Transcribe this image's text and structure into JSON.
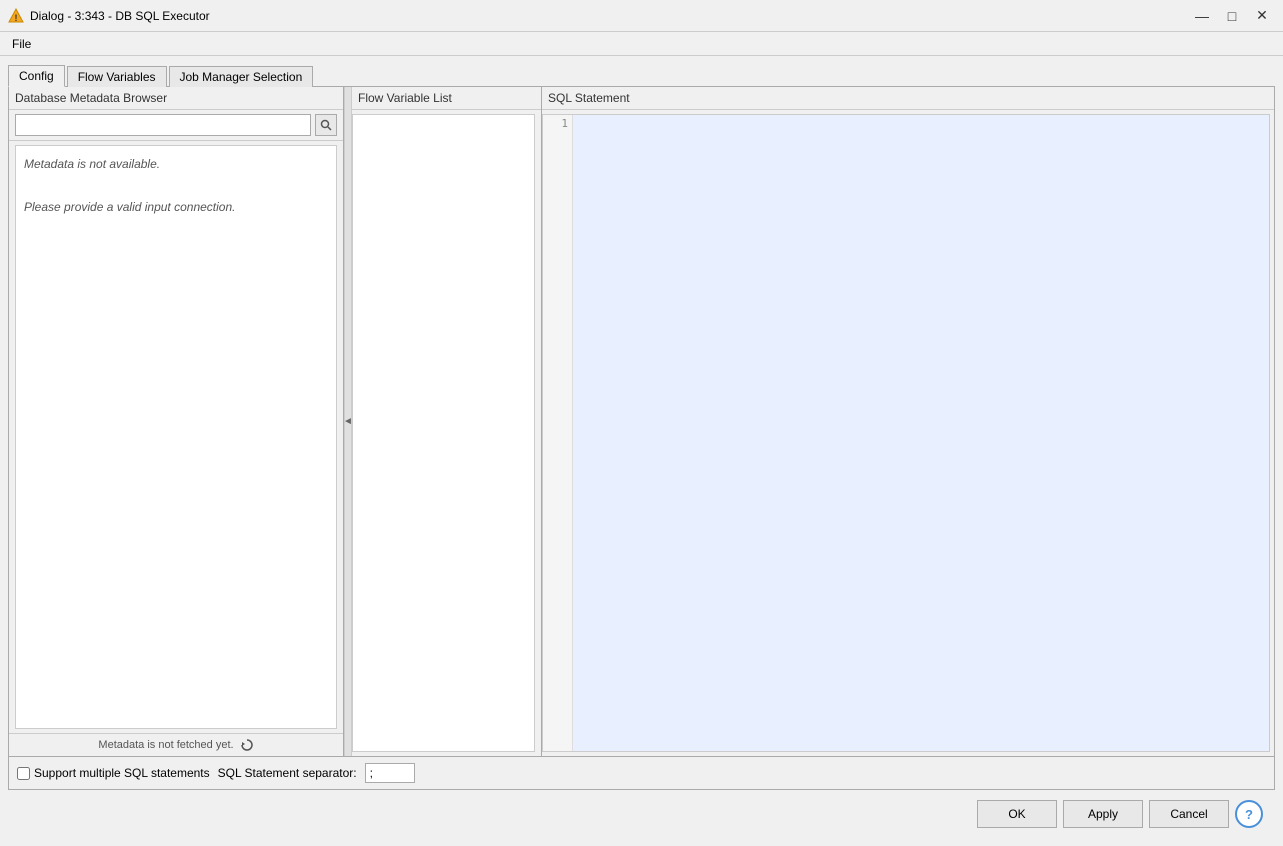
{
  "window": {
    "title": "Dialog - 3:343 - DB SQL Executor",
    "controls": {
      "minimize": "—",
      "maximize": "□",
      "close": "✕"
    }
  },
  "menu": {
    "items": [
      {
        "label": "File"
      }
    ]
  },
  "tabs": [
    {
      "label": "Config",
      "active": true
    },
    {
      "label": "Flow Variables"
    },
    {
      "label": "Job Manager Selection"
    }
  ],
  "left_panel": {
    "header": "Database Metadata Browser",
    "search_placeholder": "",
    "metadata_line1": "Metadata is not available.",
    "metadata_line2": "",
    "metadata_line3": "Please provide a valid input connection.",
    "footer_text": "Metadata is not fetched yet."
  },
  "middle_panel": {
    "header": "Flow Variable List"
  },
  "right_panel": {
    "header": "SQL Statement",
    "line_number": "1"
  },
  "options": {
    "support_multiple_label": "Support multiple SQL statements",
    "separator_label": "SQL Statement separator:",
    "separator_value": ";"
  },
  "footer": {
    "ok_label": "OK",
    "apply_label": "Apply",
    "cancel_label": "Cancel",
    "help_label": "?"
  }
}
